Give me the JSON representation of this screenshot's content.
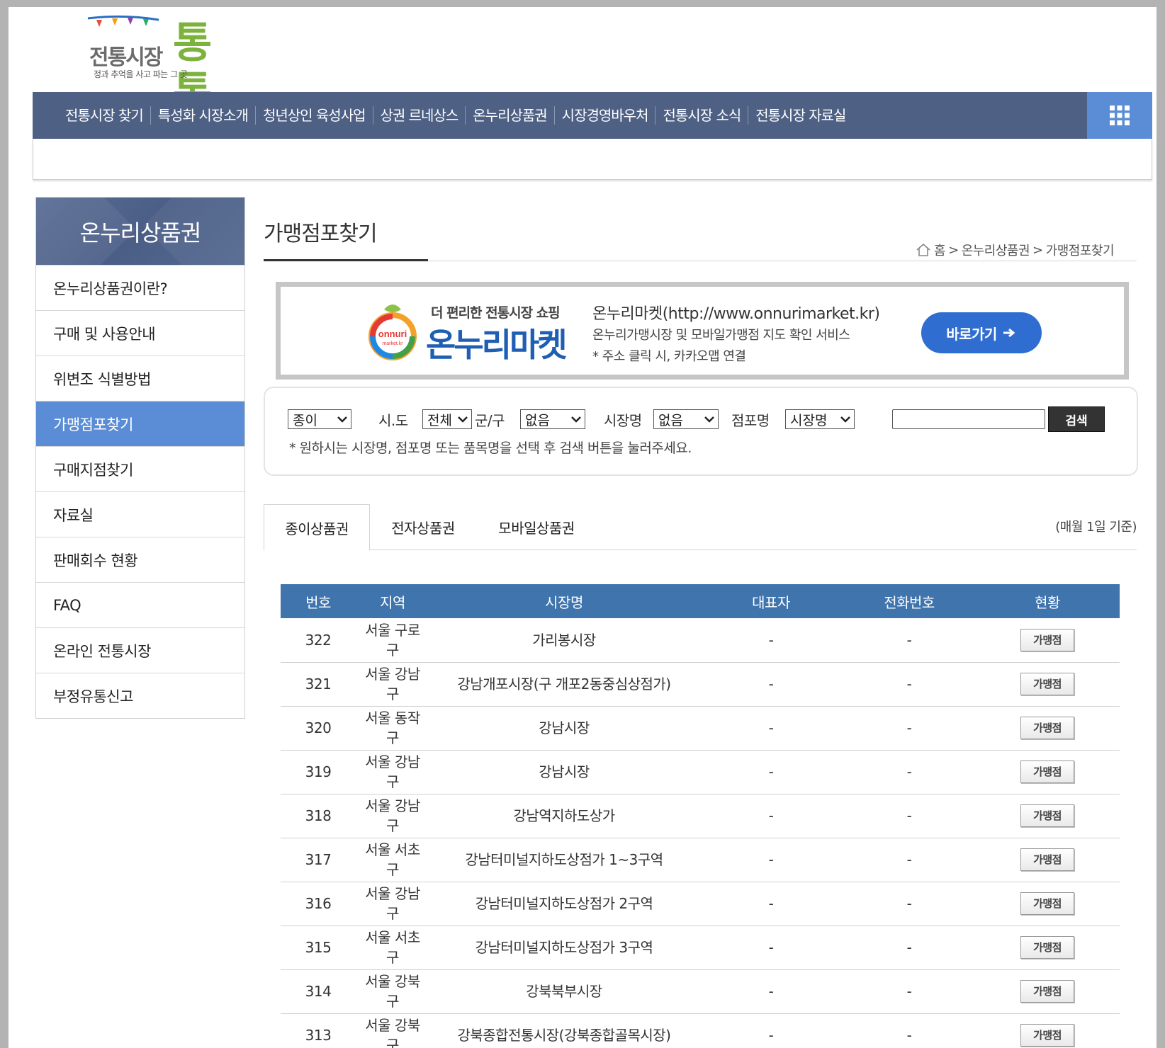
{
  "logo": {
    "main": "전통시장",
    "big": "통통",
    "tagline": "정과 추억을 사고 파는 그 곳"
  },
  "gnb": {
    "items": [
      "전통시장 찾기",
      "특성화 시장소개",
      "청년상인 육성사업",
      "상권 르네상스",
      "온누리상품권",
      "시장경영바우처",
      "전통시장 소식",
      "전통시장 자료실"
    ]
  },
  "lnb": {
    "title": "온누리상품권",
    "items": [
      "온누리상품권이란?",
      "구매 및 사용안내",
      "위변조 식별방법",
      "가맹점포찾기",
      "구매지점찾기",
      "자료실",
      "판매회수 현황",
      "FAQ",
      "온라인 전통시장",
      "부정유통신고"
    ],
    "active_index": 3
  },
  "content": {
    "title": "가맹점포찾기",
    "breadcrumb": [
      "홈",
      "온누리상품권",
      "가맹점포찾기"
    ]
  },
  "banner": {
    "small": "더 편리한 전통시장 쇼핑",
    "big": "온누리마켓",
    "logo_text1": "onnuri",
    "logo_text2": "market.kr",
    "url": "온누리마켓(http://www.onnurimarket.kr)",
    "desc1": "온누리가맹시장 및 모바일가맹점 지도 확인 서비스",
    "desc2": "* 주소 클릭 시, 카카오맵 연결",
    "button": "바로가기"
  },
  "search": {
    "type_value": "종이",
    "sido_label": "시.도",
    "sido_value": "전체",
    "gungu_label": "군/구",
    "gungu_value": "없음",
    "market_label": "시장명",
    "market_value": "없음",
    "store_label": "점포명",
    "store_value": "시장명",
    "input_value": "",
    "button": "검색",
    "note": "* 원하시는 시장명, 점포명 또는 품목명을 선택 후 검색 버튼을 눌러주세요."
  },
  "tabs": {
    "items": [
      "종이상품권",
      "전자상품권",
      "모바일상품권"
    ],
    "active_index": 0,
    "basis": "(매월 1일 기준)"
  },
  "table": {
    "headers": [
      "번호",
      "지역",
      "시장명",
      "대표자",
      "전화번호",
      "현황"
    ],
    "button_label": "가맹점",
    "rows": [
      {
        "no": "322",
        "region1": "서울 구로",
        "region2": "구",
        "market": "가리봉시장",
        "rep": "-",
        "phone": "-"
      },
      {
        "no": "321",
        "region1": "서울 강남",
        "region2": "구",
        "market": "강남개포시장(구 개포2동중심상점가)",
        "rep": "-",
        "phone": "-"
      },
      {
        "no": "320",
        "region1": "서울 동작",
        "region2": "구",
        "market": "강남시장",
        "rep": "-",
        "phone": "-"
      },
      {
        "no": "319",
        "region1": "서울 강남",
        "region2": "구",
        "market": "강남시장",
        "rep": "-",
        "phone": "-"
      },
      {
        "no": "318",
        "region1": "서울 강남",
        "region2": "구",
        "market": "강남역지하도상가",
        "rep": "-",
        "phone": "-"
      },
      {
        "no": "317",
        "region1": "서울 서초",
        "region2": "구",
        "market": "강남터미널지하도상점가 1~3구역",
        "rep": "-",
        "phone": "-"
      },
      {
        "no": "316",
        "region1": "서울 강남",
        "region2": "구",
        "market": "강남터미널지하도상점가 2구역",
        "rep": "-",
        "phone": "-"
      },
      {
        "no": "315",
        "region1": "서울 서초",
        "region2": "구",
        "market": "강남터미널지하도상점가 3구역",
        "rep": "-",
        "phone": "-"
      },
      {
        "no": "314",
        "region1": "서울 강북",
        "region2": "구",
        "market": "강북북부시장",
        "rep": "-",
        "phone": "-"
      },
      {
        "no": "313",
        "region1": "서울 강북",
        "region2": "구",
        "market": "강북종합전통시장(강북종합골목시장)",
        "rep": "-",
        "phone": "-"
      }
    ]
  },
  "colors": {
    "gnb_bg": "#4e6084",
    "accent_blue": "#5b8dd6",
    "table_header": "#3f74ad",
    "banner_button": "#2f6ed0",
    "logo_green": "#7cb33c"
  }
}
